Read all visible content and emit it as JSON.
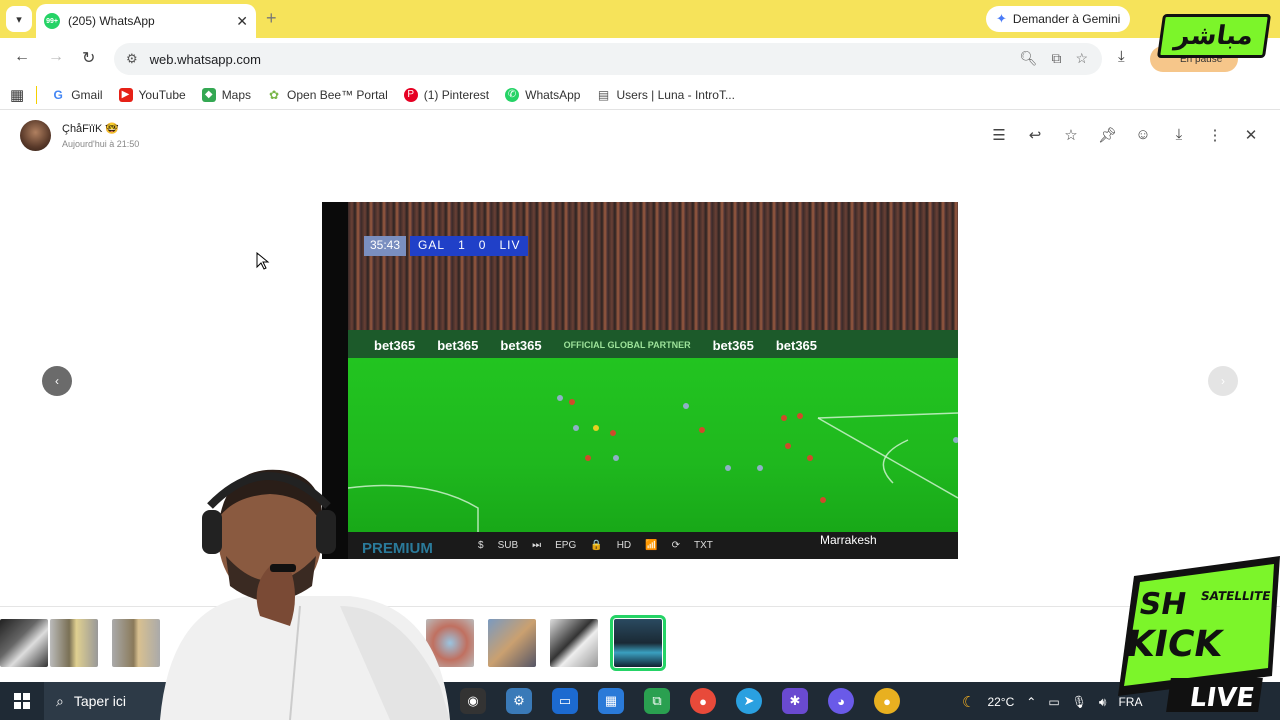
{
  "browser": {
    "tab": {
      "badge": "99+",
      "title": "(205) WhatsApp",
      "close": "✕"
    },
    "new_tab": "+",
    "gemini_label": "Demander à Gemini",
    "url": "web.whatsapp.com",
    "pause_label": "En pause"
  },
  "bookmarks": [
    {
      "label": "Gmail",
      "icon": "gmail-icon"
    },
    {
      "label": "YouTube",
      "icon": "youtube-icon"
    },
    {
      "label": "Maps",
      "icon": "maps-icon"
    },
    {
      "label": "Open Bee™ Portal",
      "icon": "openbee-icon"
    },
    {
      "label": "(1) Pinterest",
      "icon": "pinterest-icon"
    },
    {
      "label": "WhatsApp",
      "icon": "whatsapp-icon"
    },
    {
      "label": "Users | Luna - IntroT...",
      "icon": "table-icon"
    }
  ],
  "viewer": {
    "sender": "ÇhåFïïK 🤓",
    "timestamp": "Aujourd'hui à 21:50",
    "prev": "‹",
    "next": "›"
  },
  "media": {
    "clock": "35:43",
    "home": "GAL",
    "home_score": "1",
    "away_score": "0",
    "away": "LIV",
    "ads": [
      "bet365",
      "bet365",
      "bet365",
      "OFFICIAL GLOBAL PARTNER",
      "bet365",
      "bet365"
    ],
    "tv_bar": [
      "$",
      "SUB",
      "⏭",
      "EPG",
      "🔒",
      "HD",
      "📶",
      "⟳",
      "TXT"
    ],
    "overlay_brand": "PREMIUM",
    "city": "Marrakesh"
  },
  "taskbar": {
    "search_placeholder": "Taper ici",
    "temperature": "22°C",
    "language": "FRA"
  },
  "overlays": {
    "top_logo": "مباشر",
    "bottom_logo_lines": [
      "SH",
      "SATELLITE",
      "KICK",
      "LIVE"
    ]
  }
}
